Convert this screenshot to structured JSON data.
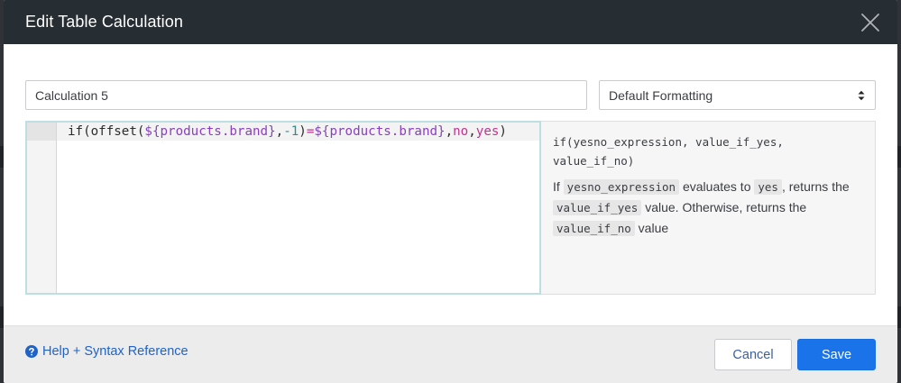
{
  "dialog": {
    "title": "Edit Table Calculation"
  },
  "form": {
    "name_value": "Calculation 5",
    "format_selected": "Default Formatting"
  },
  "editor": {
    "tokens": [
      {
        "text": "if(offset(",
        "kind": "fn"
      },
      {
        "text": "${products.brand}",
        "kind": "field"
      },
      {
        "text": ",",
        "kind": "fn"
      },
      {
        "text": "-1",
        "kind": "num"
      },
      {
        "text": ")",
        "kind": "fn"
      },
      {
        "text": "=",
        "kind": "op"
      },
      {
        "text": "${products.brand}",
        "kind": "field"
      },
      {
        "text": ",",
        "kind": "fn"
      },
      {
        "text": "no",
        "kind": "kw"
      },
      {
        "text": ",",
        "kind": "fn"
      },
      {
        "text": "yes",
        "kind": "kw"
      },
      {
        "text": ")",
        "kind": "fn"
      }
    ]
  },
  "help": {
    "signature": "if(yesno_expression, value_if_yes, value_if_no)",
    "desc_1": "If ",
    "chip_1": "yesno_expression",
    "desc_2": " evaluates to ",
    "chip_2": "yes",
    "desc_3": ", returns the ",
    "chip_3": "value_if_yes",
    "desc_4": " value. Otherwise, returns the ",
    "chip_4": "value_if_no",
    "desc_5": " value"
  },
  "footer": {
    "help_link": "Help + Syntax Reference",
    "cancel_label": "Cancel",
    "save_label": "Save"
  },
  "colors": {
    "header_bg": "#262d33",
    "primary": "#1a73e8",
    "link": "#1f63c9",
    "field_token": "#8a3fc0",
    "keyword_token": "#c0338f",
    "number_token": "#2a8f94"
  },
  "icons": {
    "close": "close-icon",
    "select": "select-arrows-icon",
    "help": "question-circle-icon"
  }
}
